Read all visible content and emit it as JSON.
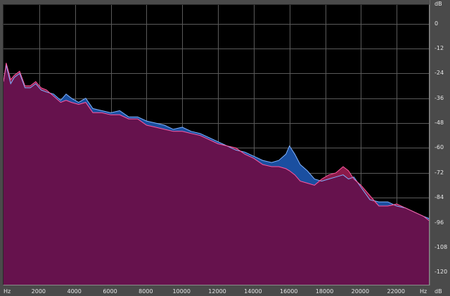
{
  "chart_data": {
    "type": "area",
    "xlabel": "Hz",
    "ylabel": "dB",
    "xlim": [
      0,
      23800
    ],
    "ylim": [
      -126,
      9
    ],
    "x_ticks": [
      2000,
      4000,
      6000,
      8000,
      10000,
      12000,
      14000,
      16000,
      18000,
      20000,
      22000
    ],
    "x_tick_labels": [
      "2000",
      "4000",
      "6000",
      "8000",
      "10000",
      "12000",
      "14000",
      "16000",
      "18000",
      "20000",
      "22000"
    ],
    "y_ticks": [
      0,
      -12,
      -24,
      -36,
      -48,
      -60,
      -72,
      -84,
      -96,
      -108,
      -120
    ],
    "y_tick_labels": [
      "0",
      "-12",
      "-24",
      "-36",
      "-48",
      "-60",
      "-72",
      "-84",
      "-96",
      "-108",
      "-120"
    ],
    "grid": true,
    "series": [
      {
        "color": "#1a4fa0",
        "x": [
          0,
          150,
          400,
          600,
          900,
          1200,
          1500,
          1800,
          2100,
          2400,
          2800,
          3200,
          3500,
          3800,
          4200,
          4600,
          5000,
          5500,
          6000,
          6500,
          7000,
          7500,
          8000,
          8500,
          9000,
          9500,
          10000,
          10500,
          11000,
          11500,
          12000,
          12500,
          13000,
          13500,
          14000,
          14500,
          15000,
          15400,
          15800,
          16000,
          16300,
          16600,
          17000,
          17400,
          17800,
          18200,
          18600,
          19000,
          19300,
          19600,
          20000,
          20500,
          21000,
          21500,
          22000,
          22500,
          23000,
          23500,
          23800
        ],
        "y": [
          -28,
          -20,
          -29,
          -26,
          -24,
          -31,
          -31,
          -29,
          -32,
          -33,
          -34,
          -37,
          -34,
          -36,
          -38,
          -36,
          -41,
          -42,
          -43,
          -42,
          -45,
          -45,
          -47,
          -48,
          -49,
          -51,
          -50,
          -52,
          -53,
          -55,
          -57,
          -59,
          -61,
          -62,
          -64,
          -66,
          -67,
          -66,
          -63,
          -59,
          -63,
          -68,
          -71,
          -75,
          -76,
          -75,
          -74,
          -73,
          -75,
          -74,
          -79,
          -85,
          -86,
          -86,
          -88,
          -89,
          -91,
          -93,
          -94
        ]
      },
      {
        "color": "#8b1a4a",
        "x": [
          0,
          150,
          400,
          600,
          900,
          1200,
          1500,
          1800,
          2100,
          2400,
          2800,
          3200,
          3500,
          3800,
          4200,
          4600,
          5000,
          5500,
          6000,
          6500,
          7000,
          7500,
          8000,
          8500,
          9000,
          9500,
          10000,
          10500,
          11000,
          11500,
          12000,
          12500,
          13000,
          13500,
          14000,
          14500,
          15000,
          15400,
          15800,
          16000,
          16300,
          16600,
          17000,
          17400,
          17800,
          18200,
          18600,
          19000,
          19300,
          19600,
          20000,
          20500,
          21000,
          21500,
          22000,
          22500,
          23000,
          23500,
          23800
        ],
        "y": [
          -28,
          -19,
          -27,
          -25,
          -23,
          -30,
          -30,
          -28,
          -31,
          -32,
          -35,
          -38,
          -37,
          -38,
          -39,
          -38,
          -43,
          -43,
          -44,
          -44,
          -46,
          -46,
          -49,
          -50,
          -51,
          -52,
          -52,
          -53,
          -54,
          -56,
          -58,
          -59,
          -60,
          -63,
          -65,
          -68,
          -69,
          -69,
          -70,
          -71,
          -73,
          -76,
          -77,
          -78,
          -75,
          -73,
          -72,
          -69,
          -71,
          -75,
          -78,
          -83,
          -88,
          -88,
          -87,
          -89,
          -91,
          -93,
          -95
        ]
      }
    ]
  },
  "colors": {
    "background": "#000000",
    "grid": "#5a5a5a",
    "series_a_fill": "#1a4fa0",
    "series_a_edge": "#7fb2ff",
    "series_b_fill": "#8b1a4a",
    "series_b_edge": "#ff5aa0",
    "overlap_fill": "#66124d"
  }
}
